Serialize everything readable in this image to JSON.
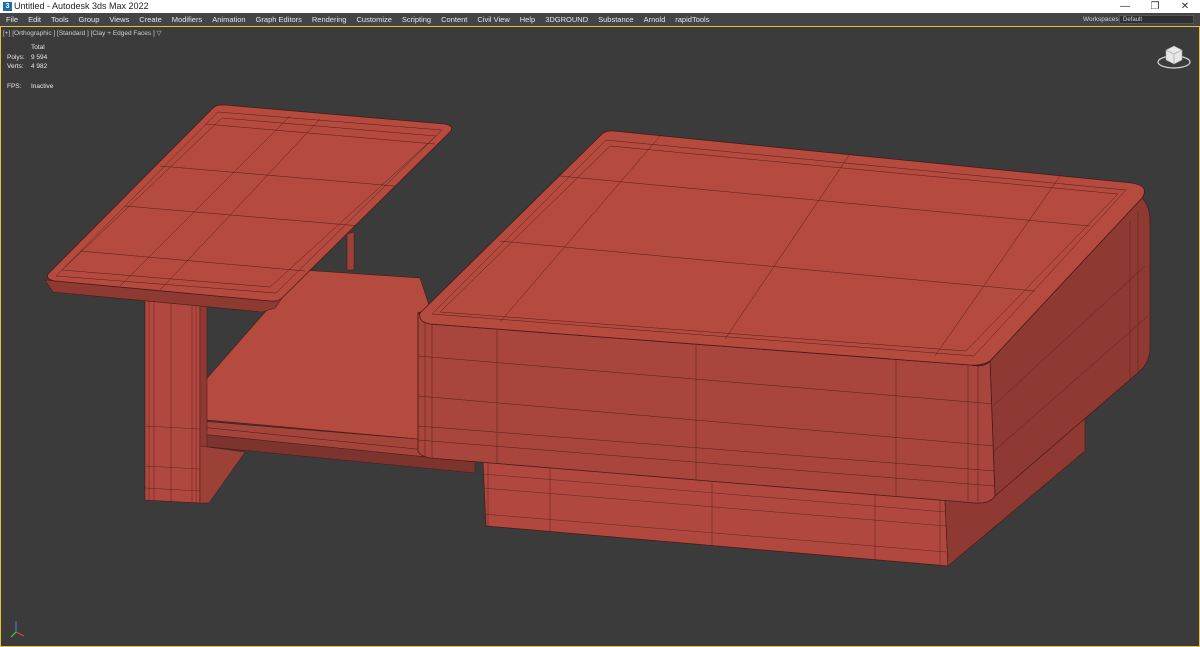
{
  "window": {
    "title": "Untitled - Autodesk 3ds Max 2022",
    "app_icon": "3",
    "controls": {
      "minimize": "—",
      "maximize": "❐",
      "close": "✕"
    }
  },
  "menubar": {
    "items": [
      "File",
      "Edit",
      "Tools",
      "Group",
      "Views",
      "Create",
      "Modifiers",
      "Animation",
      "Graph Editors",
      "Rendering",
      "Customize",
      "Scripting",
      "Content",
      "Civil View",
      "Help",
      "3DGROUND",
      "Substance",
      "Arnold",
      "rapidTools"
    ],
    "workspaces_label": "Workspaces:",
    "workspace_value": "Default"
  },
  "viewport": {
    "label": "[+] [Orthographic ] [Standard ] [Clay + Edged Faces ]  ▽",
    "stats": {
      "header": "Total",
      "polys_label": "Polys:",
      "polys_value": "9 594",
      "verts_label": "Verts:",
      "verts_value": "4 982",
      "fps_label": "FPS:",
      "fps_value": "Inactive"
    },
    "icons": [
      "viewcube-icon",
      "axis-tripod-icon",
      "filter-icon"
    ]
  },
  "colors": {
    "viewport_bg": "#3b3b3b",
    "clay": "#b54a3f",
    "clay_dark": "#8e3a33",
    "wire": "#4a1a15",
    "active_border": "#e2c23a"
  }
}
